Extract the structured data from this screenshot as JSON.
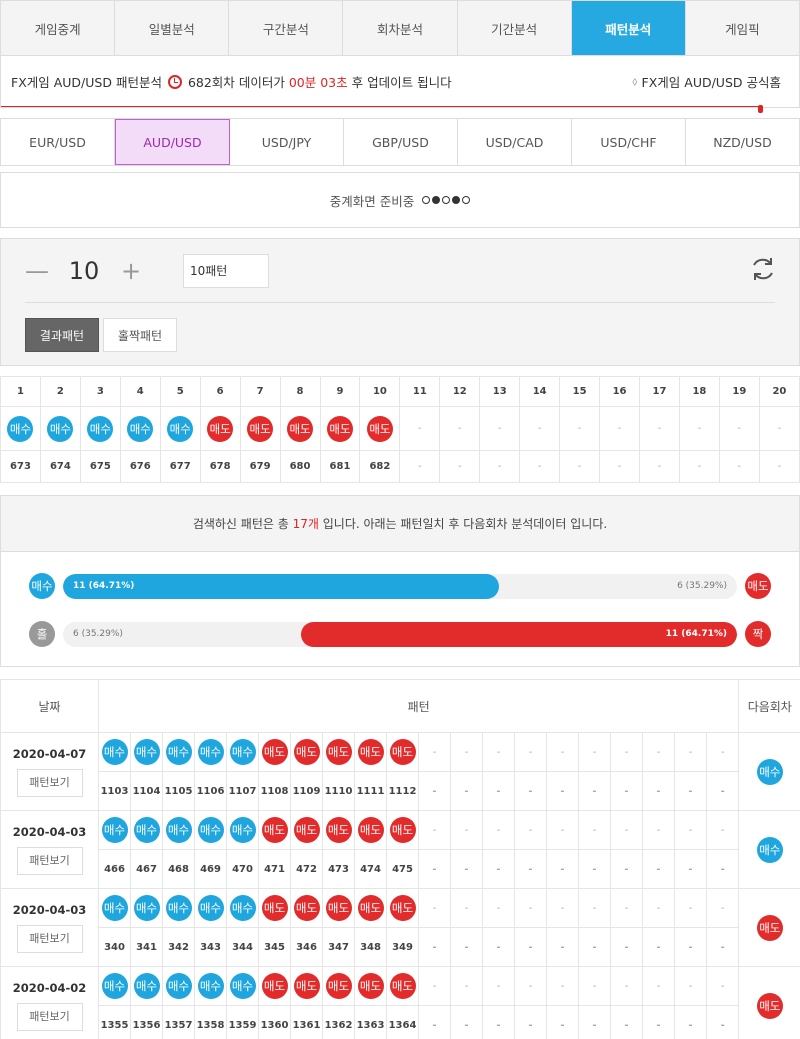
{
  "nav": {
    "tabs": [
      {
        "label": "게임중계"
      },
      {
        "label": "일별분석"
      },
      {
        "label": "구간분석"
      },
      {
        "label": "회차분석"
      },
      {
        "label": "기간분석"
      },
      {
        "label": "패턴분석",
        "active": true
      },
      {
        "label": "게임픽"
      }
    ]
  },
  "info": {
    "prefix": "FX게임 AUD/USD 패턴분석",
    "round": "682회차",
    "mid": "데이터가",
    "timer": "00분 03초",
    "suffix": "후 업데이트 됩니다",
    "official": "FX게임 AUD/USD 공식홈"
  },
  "pairs": [
    {
      "label": "EUR/USD"
    },
    {
      "label": "AUD/USD",
      "active": true
    },
    {
      "label": "USD/JPY"
    },
    {
      "label": "GBP/USD"
    },
    {
      "label": "USD/CAD"
    },
    {
      "label": "USD/CHF"
    },
    {
      "label": "NZD/USD"
    }
  ],
  "notice": {
    "text": "중계화면 준비중"
  },
  "control": {
    "count": "10",
    "minus": "—",
    "plus": "+",
    "select": "10패턴",
    "modes": [
      "결과패턴",
      "홀짝패턴"
    ]
  },
  "labels": {
    "buy": "매수",
    "sell": "매도",
    "odd": "홀",
    "even": "짝",
    "empty": "-"
  },
  "pattern": {
    "cols": [
      "1",
      "2",
      "3",
      "4",
      "5",
      "6",
      "7",
      "8",
      "9",
      "10",
      "11",
      "12",
      "13",
      "14",
      "15",
      "16",
      "17",
      "18",
      "19",
      "20"
    ],
    "results": [
      "buy",
      "buy",
      "buy",
      "buy",
      "buy",
      "sell",
      "sell",
      "sell",
      "sell",
      "sell"
    ],
    "rounds": [
      "673",
      "674",
      "675",
      "676",
      "677",
      "678",
      "679",
      "680",
      "681",
      "682"
    ]
  },
  "summary": {
    "pre": "검색하신 패턴은 총",
    "count": "17개",
    "post": "입니다. 아래는 패턴일치 후 다음회차 분석데이터 입니다."
  },
  "stats": {
    "buy": {
      "label": "11 (64.71%)",
      "pct": 64.71
    },
    "sell": {
      "label": "6 (35.29%)"
    },
    "odd": {
      "label": "6 (35.29%)"
    },
    "even": {
      "label": "11 (64.71%)",
      "pct": 64.71
    }
  },
  "history": {
    "headers": {
      "date": "날짜",
      "pattern": "패턴",
      "next": "다음회차"
    },
    "view_label": "패턴보기",
    "rows": [
      {
        "date": "2020-04-07",
        "results": [
          "buy",
          "buy",
          "buy",
          "buy",
          "buy",
          "sell",
          "sell",
          "sell",
          "sell",
          "sell"
        ],
        "rounds": [
          "1103",
          "1104",
          "1105",
          "1106",
          "1107",
          "1108",
          "1109",
          "1110",
          "1111",
          "1112"
        ],
        "next": "buy"
      },
      {
        "date": "2020-04-03",
        "results": [
          "buy",
          "buy",
          "buy",
          "buy",
          "buy",
          "sell",
          "sell",
          "sell",
          "sell",
          "sell"
        ],
        "rounds": [
          "466",
          "467",
          "468",
          "469",
          "470",
          "471",
          "472",
          "473",
          "474",
          "475"
        ],
        "next": "buy"
      },
      {
        "date": "2020-04-03",
        "results": [
          "buy",
          "buy",
          "buy",
          "buy",
          "buy",
          "sell",
          "sell",
          "sell",
          "sell",
          "sell"
        ],
        "rounds": [
          "340",
          "341",
          "342",
          "343",
          "344",
          "345",
          "346",
          "347",
          "348",
          "349"
        ],
        "next": "sell"
      },
      {
        "date": "2020-04-02",
        "results": [
          "buy",
          "buy",
          "buy",
          "buy",
          "buy",
          "sell",
          "sell",
          "sell",
          "sell",
          "sell"
        ],
        "rounds": [
          "1355",
          "1356",
          "1357",
          "1358",
          "1359",
          "1360",
          "1361",
          "1362",
          "1363",
          "1364"
        ],
        "next": "sell"
      }
    ]
  },
  "colors": {
    "blue": "#1fa6df",
    "red": "#e22b2b",
    "accent": "#25a9e0",
    "purple": "#9c2ab5"
  }
}
